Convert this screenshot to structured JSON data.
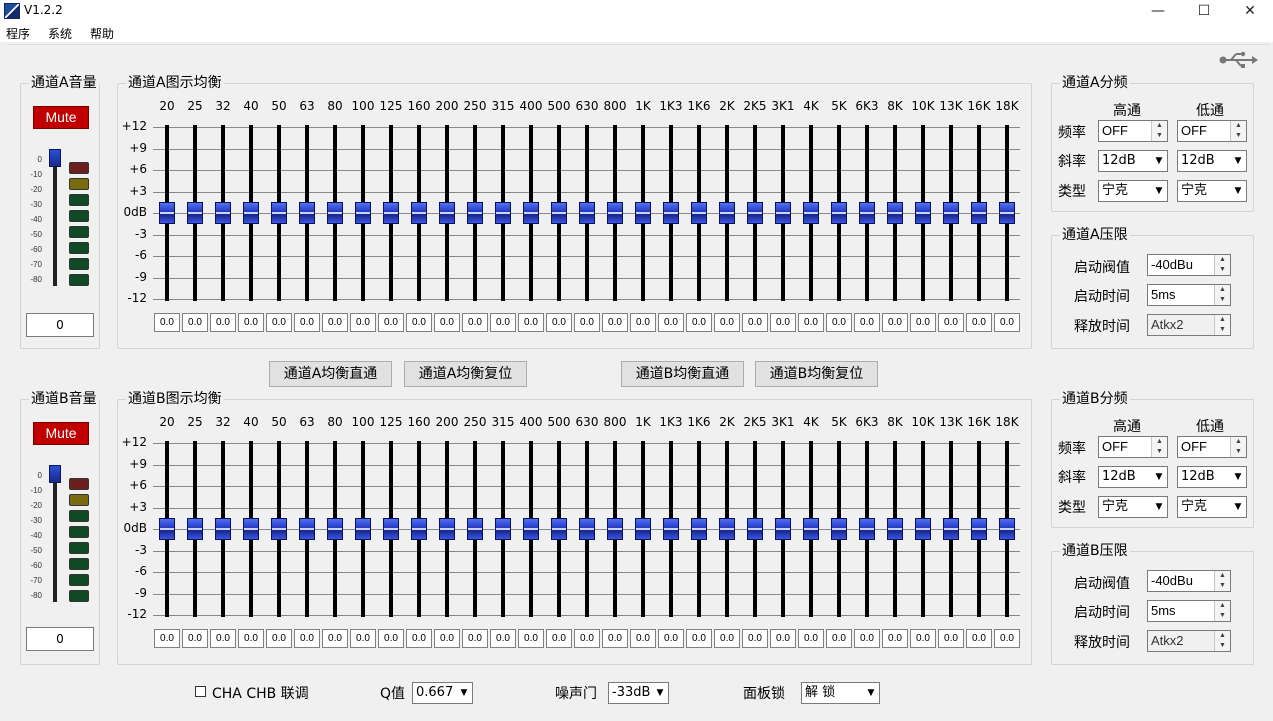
{
  "window": {
    "title": "V1.2.2",
    "minimize": "—",
    "maximize": "☐",
    "close": "✕"
  },
  "menu": [
    "程序",
    "系统",
    "帮助"
  ],
  "freqs": [
    "20",
    "25",
    "32",
    "40",
    "50",
    "63",
    "80",
    "100",
    "125",
    "160",
    "200",
    "250",
    "315",
    "400",
    "500",
    "630",
    "800",
    "1K",
    "1K3",
    "1K6",
    "2K",
    "2K5",
    "3K1",
    "4K",
    "5K",
    "6K3",
    "8K",
    "10K",
    "13K",
    "16K",
    "18K"
  ],
  "db_labels": [
    "+12",
    "+9",
    "+6",
    "+3",
    "0dB",
    "-3",
    "-6",
    "-9",
    "-12"
  ],
  "vol_scale": [
    "0",
    "-10",
    "-20",
    "-30",
    "-40",
    "-50",
    "-60",
    "-70",
    "-80"
  ],
  "led_colors": [
    "#6b1f1f",
    "#7a6a10",
    "#0f4a24",
    "#0f4a24",
    "#0f4a24",
    "#0f4a24",
    "#0f4a24",
    "#0f4a24"
  ],
  "eq_band_value": "0.0",
  "channel_a": {
    "volume_title": "通道A音量",
    "mute_label": "Mute",
    "volume_value": "0",
    "eq_title": "通道A图示均衡",
    "xover_title": "通道A分频",
    "hp_header": "高通",
    "lp_header": "低通",
    "freq_label": "频率",
    "slope_label": "斜率",
    "type_label": "类型",
    "hp_freq": "OFF",
    "lp_freq": "OFF",
    "hp_slope": "12dB",
    "lp_slope": "12dB",
    "hp_type": "宁克",
    "lp_type": "宁克",
    "limiter_title": "通道A压限",
    "threshold_label": "启动阀值",
    "threshold": "-40dBu",
    "attack_label": "启动时间",
    "attack": "5ms",
    "release_label": "释放时间",
    "release": "Atkx2"
  },
  "channel_b": {
    "volume_title": "通道B音量",
    "mute_label": "Mute",
    "volume_value": "0",
    "eq_title": "通道B图示均衡",
    "xover_title": "通道B分频",
    "hp_header": "高通",
    "lp_header": "低通",
    "freq_label": "频率",
    "slope_label": "斜率",
    "type_label": "类型",
    "hp_freq": "OFF",
    "lp_freq": "OFF",
    "hp_slope": "12dB",
    "lp_slope": "12dB",
    "hp_type": "宁克",
    "lp_type": "宁克",
    "limiter_title": "通道B压限",
    "threshold_label": "启动阀值",
    "threshold": "-40dBu",
    "attack_label": "启动时间",
    "attack": "5ms",
    "release_label": "释放时间",
    "release": "Atkx2"
  },
  "buttons": {
    "a_bypass": "通道A均衡直通",
    "a_reset": "通道A均衡复位",
    "b_bypass": "通道B均衡直通",
    "b_reset": "通道B均衡复位"
  },
  "bottom": {
    "link_label": "CHA  CHB 联调",
    "q_label": "Q值",
    "q_value": "0.667",
    "gate_label": "噪声门",
    "gate_value": "-33dB",
    "lock_label": "面板锁",
    "lock_value": "解    锁"
  }
}
